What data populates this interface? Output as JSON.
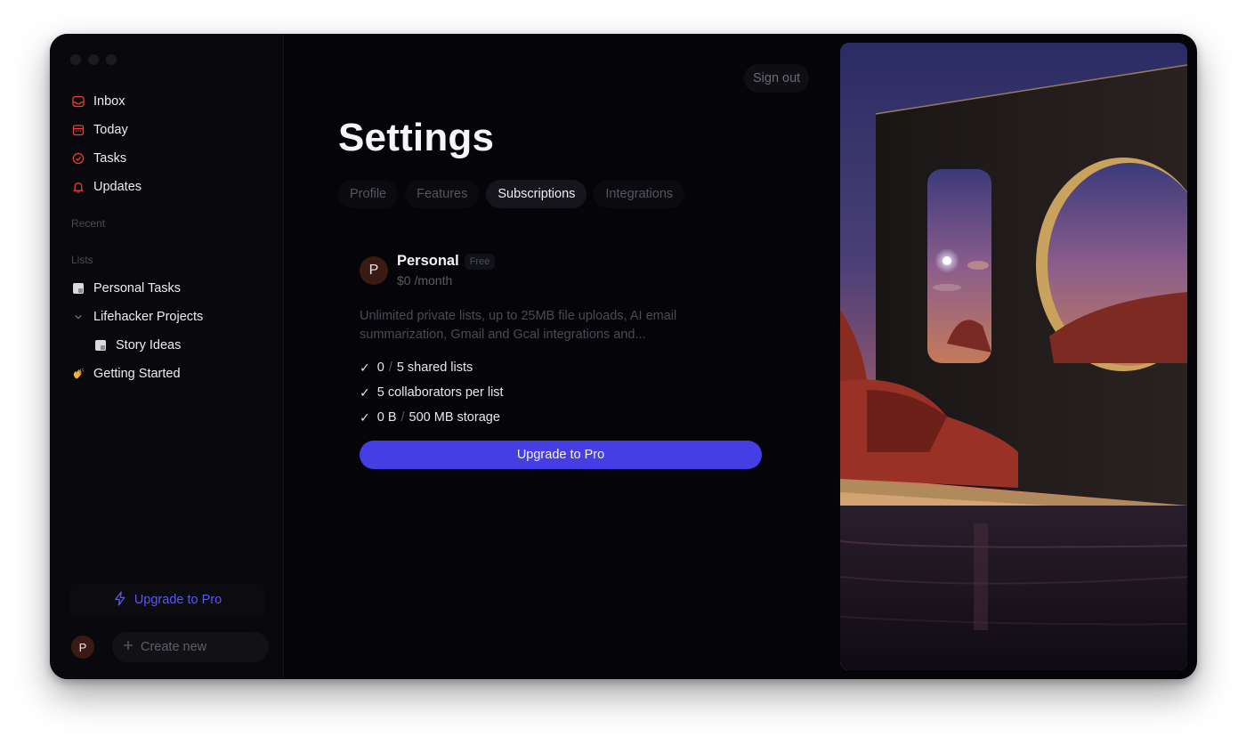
{
  "sidebar": {
    "nav": [
      {
        "label": "Inbox",
        "icon": "inbox-icon"
      },
      {
        "label": "Today",
        "icon": "calendar-icon"
      },
      {
        "label": "Tasks",
        "icon": "check-circle-icon"
      },
      {
        "label": "Updates",
        "icon": "bell-icon"
      }
    ],
    "recent_label": "Recent",
    "lists_label": "Lists",
    "lists": [
      {
        "label": "Personal Tasks",
        "icon": "note-icon"
      },
      {
        "label": "Lifehacker Projects",
        "icon": "chevron-down-icon"
      },
      {
        "label": "Story Ideas",
        "icon": "note-icon"
      },
      {
        "label": "Getting Started",
        "icon": "waving-hand-icon"
      }
    ],
    "upgrade_label": "Upgrade to Pro",
    "avatar_initial": "P",
    "create_new_label": "Create new"
  },
  "main": {
    "sign_out_label": "Sign out",
    "title": "Settings",
    "tabs": [
      {
        "label": "Profile",
        "active": false
      },
      {
        "label": "Features",
        "active": false
      },
      {
        "label": "Subscriptions",
        "active": true
      },
      {
        "label": "Integrations",
        "active": false
      }
    ],
    "plan": {
      "avatar_initial": "P",
      "name": "Personal",
      "badge": "Free",
      "price": "$0 /month",
      "description": "Unlimited private lists, up to 25MB file uploads, AI email summarization, Gmail and Gcal integrations and...",
      "features": {
        "shared_used": "0",
        "shared_total": "5 shared lists",
        "collaborators": "5 collaborators per list",
        "storage_used": "0 B",
        "storage_total": "500 MB storage"
      },
      "upgrade_label": "Upgrade to Pro"
    }
  },
  "colors": {
    "accent": "#453ee4",
    "accent_text": "#5a56ff",
    "icon_red": "#e5432f",
    "background": "#050509"
  }
}
